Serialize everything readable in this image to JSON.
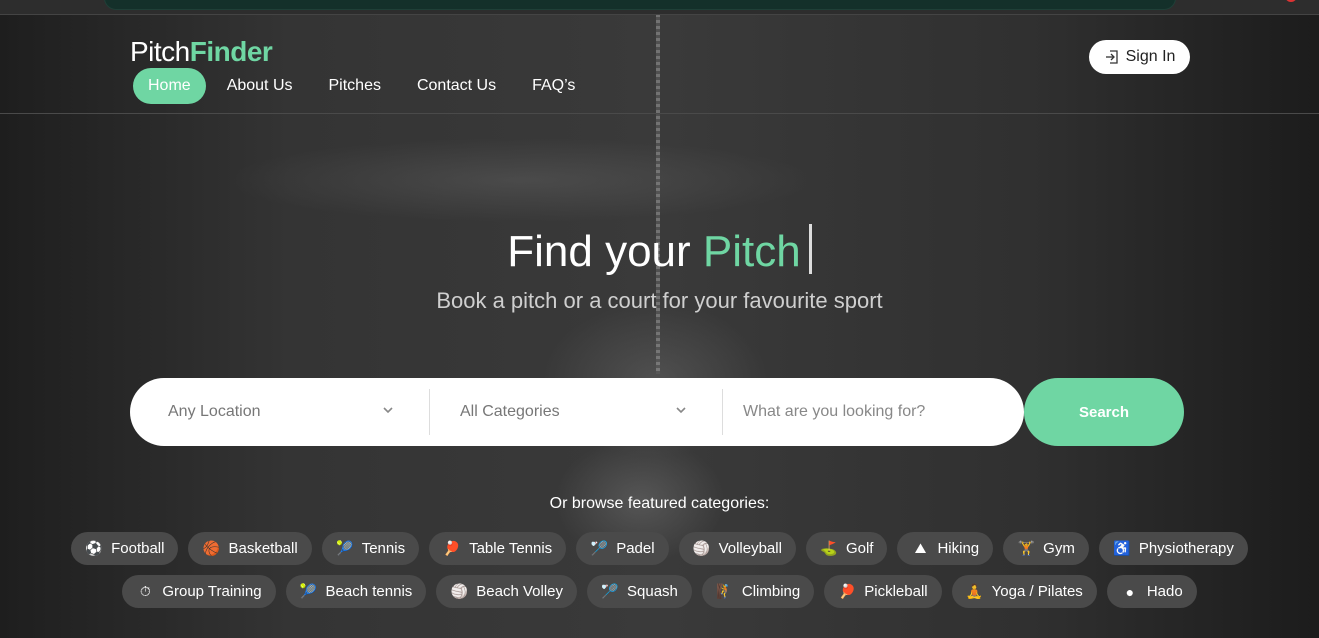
{
  "brand": {
    "part1": "Pitch",
    "part2": "Finder"
  },
  "nav": [
    {
      "label": "Home",
      "active": true
    },
    {
      "label": "About Us"
    },
    {
      "label": "Pitches"
    },
    {
      "label": "Contact Us"
    },
    {
      "label": "FAQ’s"
    }
  ],
  "signin": {
    "label": "Sign In",
    "icon": "sign-in-icon"
  },
  "hero": {
    "title_prefix": "Find your ",
    "title_highlight": "Pitch",
    "subtitle": "Book a pitch or a court for your favourite sport"
  },
  "search": {
    "location": "Any Location",
    "category": "All Categories",
    "placeholder": "What are you looking for?",
    "button": "Search"
  },
  "browse_label": "Or browse featured categories:",
  "categories_row1": [
    {
      "label": "Football",
      "icon": "football-icon",
      "glyph": "⚽"
    },
    {
      "label": "Basketball",
      "icon": "basketball-icon",
      "glyph": "🏀"
    },
    {
      "label": "Tennis",
      "icon": "tennis-racket-icon",
      "glyph": "🎾"
    },
    {
      "label": "Table Tennis",
      "icon": "table-tennis-icon",
      "glyph": "🏓"
    },
    {
      "label": "Padel",
      "icon": "padel-icon",
      "glyph": "🏸"
    },
    {
      "label": "Volleyball",
      "icon": "volleyball-icon",
      "glyph": "🏐"
    },
    {
      "label": "Golf",
      "icon": "golf-ball-icon",
      "glyph": "⛳"
    },
    {
      "label": "Hiking",
      "icon": "mountain-icon",
      "glyph": "⛰"
    },
    {
      "label": "Gym",
      "icon": "dumbbell-icon",
      "glyph": "🏋"
    },
    {
      "label": "Physiotherapy",
      "icon": "physiotherapy-icon",
      "glyph": "♿"
    }
  ],
  "categories_row2": [
    {
      "label": "Group Training",
      "icon": "stopwatch-icon",
      "glyph": "⏱"
    },
    {
      "label": "Beach tennis",
      "icon": "beach-tennis-icon",
      "glyph": "🎾"
    },
    {
      "label": "Beach Volley",
      "icon": "beach-volley-icon",
      "glyph": "🏐"
    },
    {
      "label": "Squash",
      "icon": "squash-racket-icon",
      "glyph": "🏸"
    },
    {
      "label": "Climbing",
      "icon": "climbing-icon",
      "glyph": "🧗"
    },
    {
      "label": "Pickleball",
      "icon": "pickleball-icon",
      "glyph": "🏓"
    },
    {
      "label": "Yoga / Pilates",
      "icon": "yoga-icon",
      "glyph": "🧘"
    },
    {
      "label": "Hado",
      "icon": "hado-icon",
      "glyph": "●"
    }
  ]
}
